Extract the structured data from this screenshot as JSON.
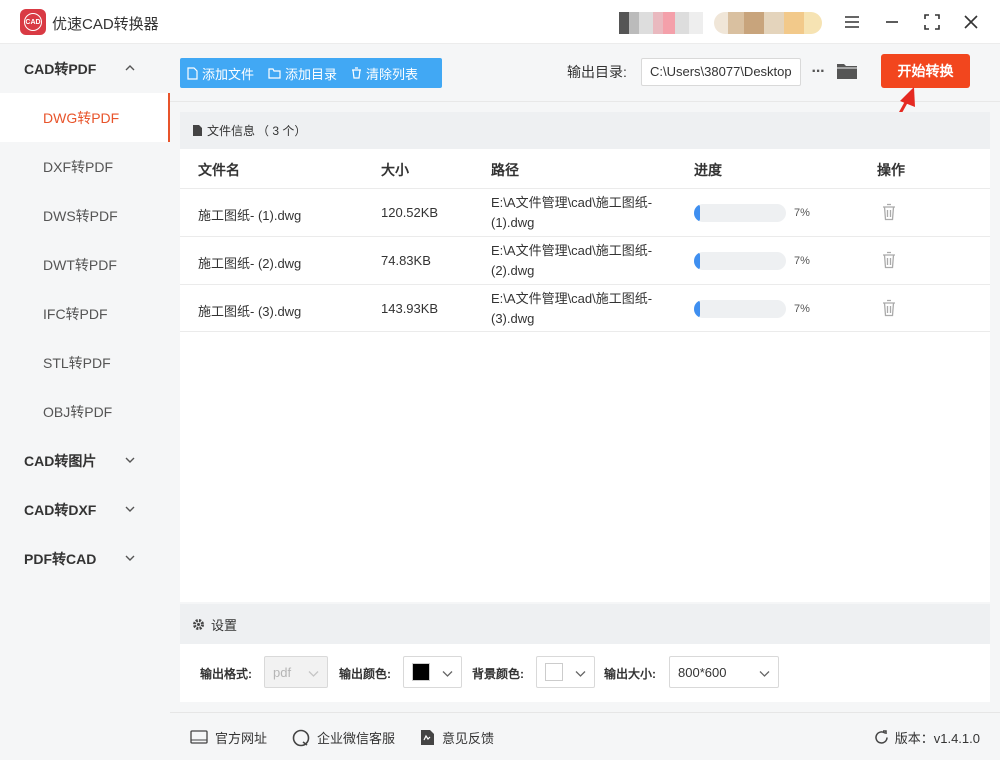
{
  "app": {
    "title": "优速CAD转换器",
    "logo_text": "CAD"
  },
  "sidebar": {
    "groups": [
      {
        "label": "CAD转PDF",
        "expanded": true,
        "items": [
          "DWG转PDF",
          "DXF转PDF",
          "DWS转PDF",
          "DWT转PDF",
          "IFC转PDF",
          "STL转PDF",
          "OBJ转PDF"
        ],
        "active_item": "DWG转PDF"
      },
      {
        "label": "CAD转图片",
        "expanded": false
      },
      {
        "label": "CAD转DXF",
        "expanded": false
      },
      {
        "label": "PDF转CAD",
        "expanded": false
      }
    ]
  },
  "toolbar": {
    "add_file": "添加文件",
    "add_folder": "添加目录",
    "clear_list": "清除列表",
    "output_dir_label": "输出目录:",
    "output_dir_value": "C:\\Users\\38077\\Desktop",
    "more": "···",
    "start_button": "开始转换"
  },
  "file_panel": {
    "header_label": "文件信息",
    "header_count": "（ 3 个）",
    "columns": {
      "name": "文件名",
      "size": "大小",
      "path": "路径",
      "progress": "进度",
      "action": "操作"
    },
    "rows": [
      {
        "name": "施工图纸- (1).dwg",
        "size": "120.52KB",
        "path": "E:\\A文件管理\\cad\\施工图纸- (1).dwg",
        "progress": 7,
        "progress_label": "7%"
      },
      {
        "name": "施工图纸- (2).dwg",
        "size": "74.83KB",
        "path": "E:\\A文件管理\\cad\\施工图纸- (2).dwg",
        "progress": 7,
        "progress_label": "7%"
      },
      {
        "name": "施工图纸- (3).dwg",
        "size": "143.93KB",
        "path": "E:\\A文件管理\\cad\\施工图纸- (3).dwg",
        "progress": 7,
        "progress_label": "7%"
      }
    ]
  },
  "settings": {
    "title": "设置",
    "format_label": "输出格式:",
    "format_value": "pdf",
    "color_label": "输出颜色:",
    "color_value": "#000000",
    "bg_label": "背景颜色:",
    "bg_value": "#ffffff",
    "size_label": "输出大小:",
    "size_value": "800*600"
  },
  "footer": {
    "website": "官方网址",
    "wechat": "企业微信客服",
    "feedback": "意见反馈",
    "version": "版本：v1.4.1.0"
  },
  "colors": {
    "accent_orange": "#e8542b",
    "start_button": "#f2461e",
    "toolbar_blue": "#41a8f4",
    "progress_blue": "#3f8ff0"
  }
}
